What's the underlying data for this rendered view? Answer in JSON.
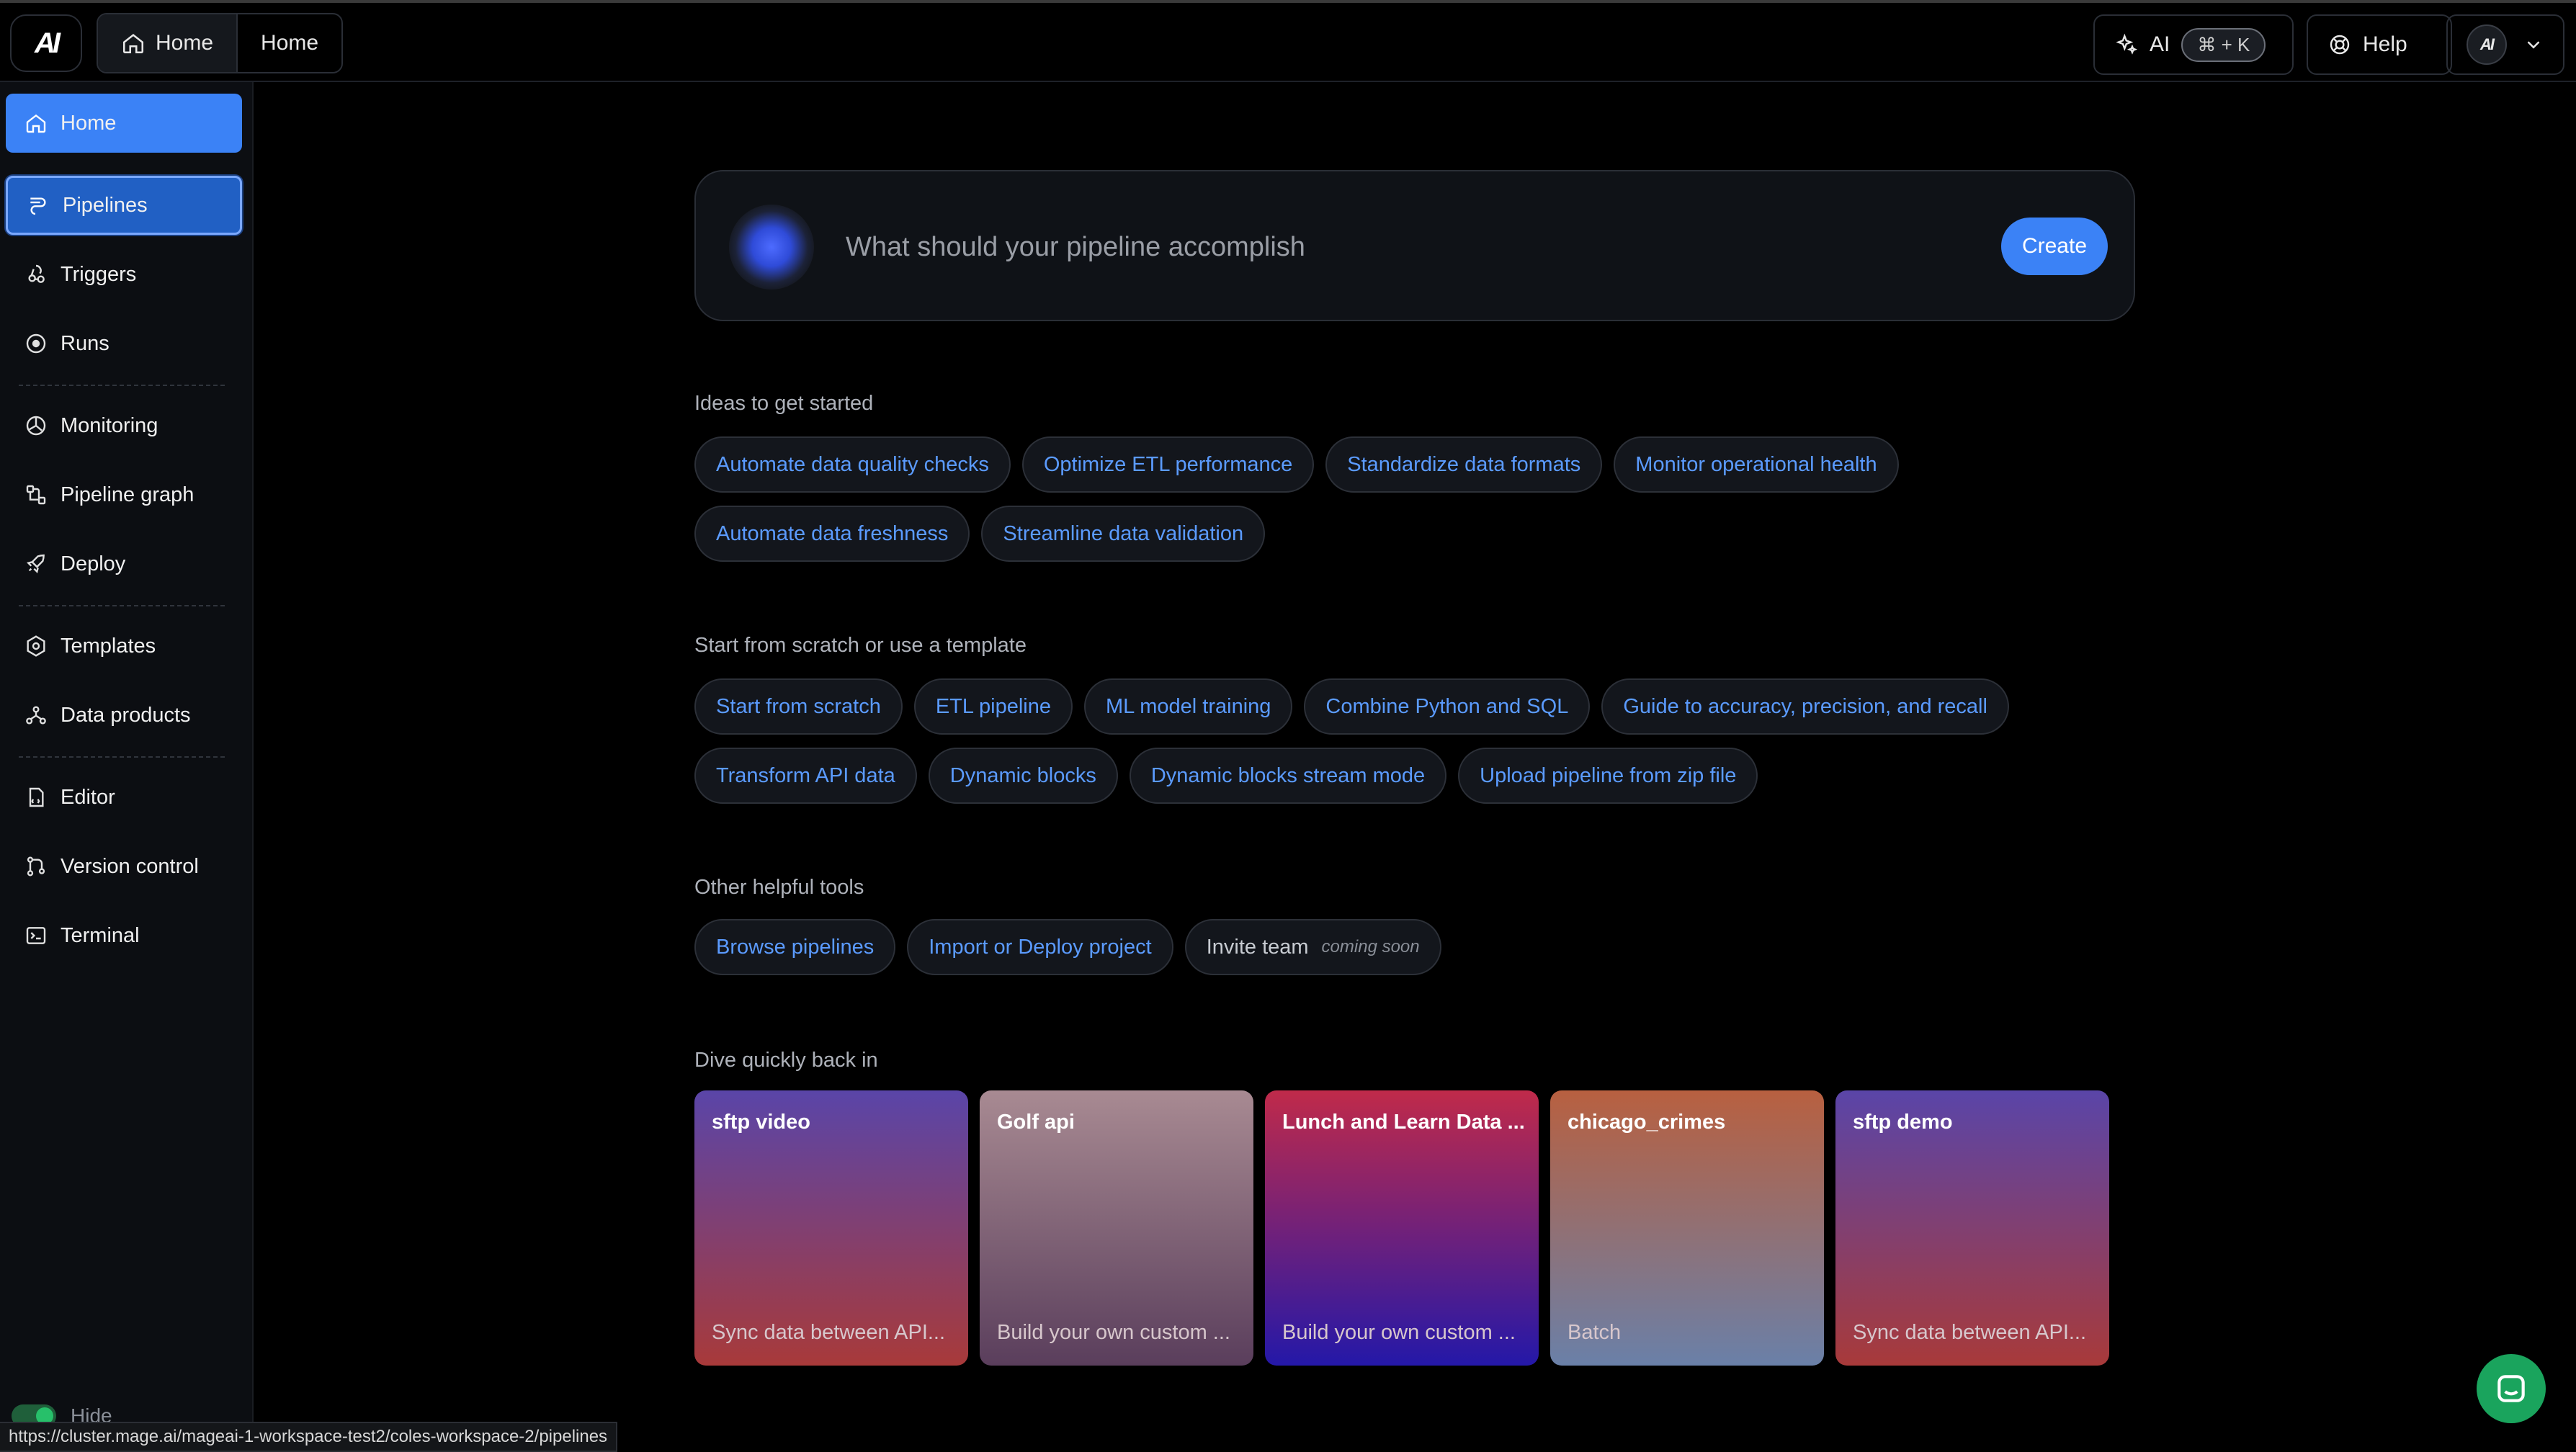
{
  "topbar": {
    "logo": "AI",
    "breadcrumbs": [
      "Home",
      "Home"
    ],
    "ai_button": {
      "label": "AI",
      "shortcut": "⌘ + K"
    },
    "help_label": "Help",
    "user_avatar": "AI"
  },
  "sidebar": {
    "items": [
      {
        "label": "Home",
        "icon": "home-icon"
      },
      {
        "label": "Pipelines",
        "icon": "pipelines-icon"
      },
      {
        "label": "Triggers",
        "icon": "triggers-icon"
      },
      {
        "label": "Runs",
        "icon": "runs-icon"
      },
      {
        "label": "Monitoring",
        "icon": "monitoring-icon"
      },
      {
        "label": "Pipeline graph",
        "icon": "pipeline-graph-icon"
      },
      {
        "label": "Deploy",
        "icon": "rocket-icon"
      },
      {
        "label": "Templates",
        "icon": "templates-icon"
      },
      {
        "label": "Data products",
        "icon": "data-products-icon"
      },
      {
        "label": "Editor",
        "icon": "editor-icon"
      },
      {
        "label": "Version control",
        "icon": "version-control-icon"
      },
      {
        "label": "Terminal",
        "icon": "terminal-icon"
      }
    ],
    "hide_label": "Hide"
  },
  "status_url": "https://cluster.mage.ai/mageai-1-workspace-test2/coles-workspace-2/pipelines",
  "prompt": {
    "placeholder": "What should your pipeline accomplish",
    "create_label": "Create"
  },
  "ideas": {
    "title": "Ideas to get started",
    "chips": [
      "Automate data quality checks",
      "Optimize ETL performance",
      "Standardize data formats",
      "Monitor operational health",
      "Automate data freshness",
      "Streamline data validation"
    ]
  },
  "templates": {
    "title": "Start from scratch or use a template",
    "chips": [
      "Start from scratch",
      "ETL pipeline",
      "ML model training",
      "Combine Python and SQL",
      "Guide to accuracy, precision, and recall",
      "Transform API data",
      "Dynamic blocks",
      "Dynamic blocks stream mode",
      "Upload pipeline from zip file"
    ]
  },
  "tools": {
    "title": "Other helpful tools",
    "chips": [
      "Browse pipelines",
      "Import or Deploy project"
    ],
    "invite": {
      "label": "Invite team",
      "badge": "coming soon"
    }
  },
  "recent": {
    "title": "Dive quickly back in",
    "cards": [
      {
        "title": "sftp video",
        "description": "Sync data between API...",
        "gradient": [
          "#5a45a8",
          "#a83a3a"
        ]
      },
      {
        "title": "Golf api",
        "description": "Build your own custom ...",
        "gradient": [
          "#a88a92",
          "#5a3e5c"
        ]
      },
      {
        "title": "Lunch and Learn Data ...",
        "description": "Build your own custom ...",
        "gradient": [
          "#c02a4a",
          "#2418a8"
        ]
      },
      {
        "title": "chicago_crimes",
        "description": "Batch",
        "gradient": [
          "#b86040",
          "#6a80a8"
        ]
      },
      {
        "title": "sftp demo",
        "description": "Sync data between API...",
        "gradient": [
          "#5a45a8",
          "#a83a3a"
        ]
      }
    ]
  },
  "colors": {
    "accent": "#3b82f6",
    "chip_text": "#5b9bff",
    "chat": "#1aa45d"
  }
}
